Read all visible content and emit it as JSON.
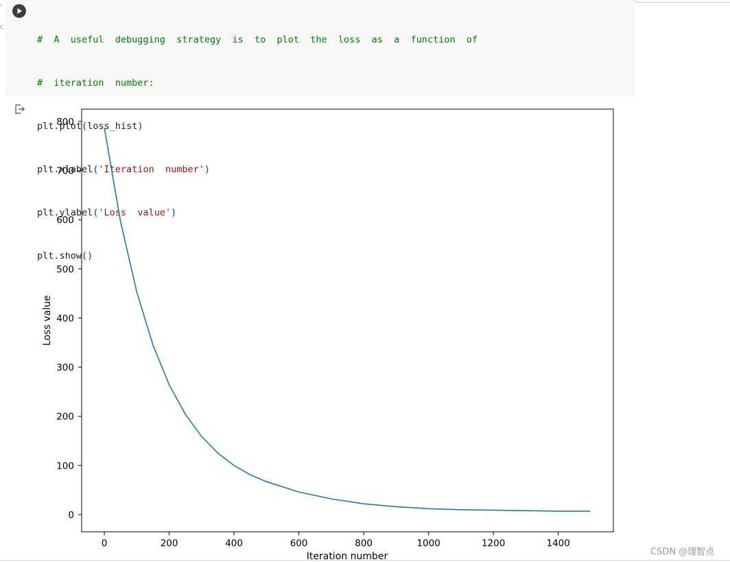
{
  "code_cell": {
    "lines": [
      "# A useful debugging strategy is to plot the loss as a function of",
      "# iteration number:",
      "plt.plot(loss_hist)",
      "plt.xlabel('Iteration number')",
      "plt.ylabel('Loss value')",
      "plt.show()"
    ],
    "tokens": {
      "l0": "#  A  useful  debugging  strategy  is  to  plot  the  loss  as  a  function  of",
      "l1": "#  iteration  number:",
      "l2_a": "plt.plot",
      "l2_p1": "(",
      "l2_b": "loss_hist",
      "l2_p2": ")",
      "l3_a": "plt.xlabel",
      "l3_p1": "(",
      "l3_s": "'Iteration  number'",
      "l3_p2": ")",
      "l4_a": "plt.ylabel",
      "l4_p1": "(",
      "l4_s": "'Loss  value'",
      "l4_p2": ")",
      "l5_a": "plt.show",
      "l5_p": "()"
    }
  },
  "icons": {
    "run": "play-circle-icon",
    "output": "output-arrow-icon"
  },
  "watermark": "CSDN @理智点",
  "colors": {
    "line": "#1f77b4",
    "code_bg": "#f7f7f7",
    "comment": "#008000",
    "string": "#a31515"
  },
  "chart_data": {
    "type": "line",
    "title": "",
    "xlabel": "Iteration number",
    "ylabel": "Loss value",
    "xlim": [
      -70,
      1570
    ],
    "ylim": [
      -35,
      825
    ],
    "xticks": [
      0,
      200,
      400,
      600,
      800,
      1000,
      1200,
      1400
    ],
    "yticks": [
      0,
      100,
      200,
      300,
      400,
      500,
      600,
      700,
      800
    ],
    "grid": false,
    "series": [
      {
        "x": [
          0,
          50,
          100,
          150,
          200,
          250,
          300,
          350,
          400,
          450,
          500,
          600,
          700,
          800,
          900,
          1000,
          1100,
          1200,
          1300,
          1400,
          1499
        ],
        "values": [
          787,
          596,
          453,
          345,
          264,
          204,
          159,
          125,
          100,
          81,
          67,
          46,
          32,
          22,
          16,
          12,
          10,
          9,
          8,
          7,
          7
        ]
      }
    ]
  }
}
